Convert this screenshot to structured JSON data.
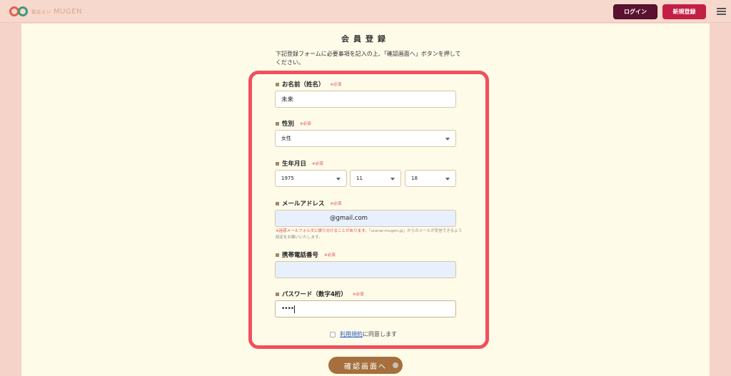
{
  "header": {
    "logo_small": "電話占い",
    "logo_text": "MUGEN",
    "login_label": "ログイン",
    "register_label": "新規登録"
  },
  "page": {
    "title": "会員登録",
    "intro": "下記登録フォームに必要事項を記入の上、「確認画面へ」ボタンを押してください。"
  },
  "form": {
    "required_mark": "※必須",
    "name": {
      "label": "お名前（姓名）",
      "value": "未来"
    },
    "gender": {
      "label": "性別",
      "value": "女性"
    },
    "birthday": {
      "label": "生年月日",
      "year": "1975",
      "month": "11",
      "day": "18"
    },
    "email": {
      "label": "メールアドレス",
      "value": "@gmail.com",
      "notice_red": "※迷惑メールフォルダに振り分けることがあります。",
      "notice_grey": "「uranai-mugen.jp」からのメールが受信できるよう設定をお願いいたします。"
    },
    "phone": {
      "label": "携帯電話番号",
      "value": ""
    },
    "password": {
      "label": "パスワード（数字4桁）",
      "value": "••••"
    },
    "agree_link": "利用規約",
    "agree_text": "に同意します",
    "confirm_label": "確認画面へ"
  },
  "colors": {
    "accent_red": "#f0505d",
    "login_bg": "#5b1230",
    "register_bg": "#c21f45",
    "confirm_bg": "#a5703d"
  }
}
